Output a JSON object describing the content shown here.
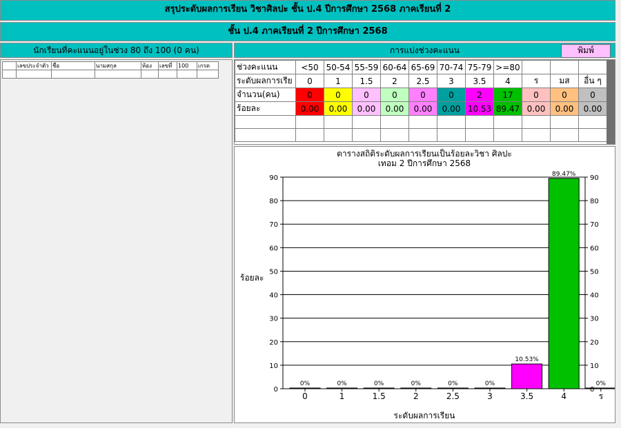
{
  "header": {
    "title": "สรุประดับผลการเรียน วิชาศิลปะ ชั้น ป.4  ปีการศึกษา  2568 ภาคเรียนที่  2",
    "subtitle": "ชั้น ป.4 ภาคเรียนที่  2  ปีการศึกษา  2568"
  },
  "left_panel": {
    "heading": "นักเรียนที่คะแนนอยู่ในช่วง 80 ถึง 100 (0 คน)",
    "columns": [
      "",
      "เลขประจำตัว",
      "ชื่อ",
      "นามสกุล",
      "ห้อง",
      "เลขที่",
      "100",
      "เกรด"
    ]
  },
  "right_panel": {
    "heading": "การแบ่งช่วงคะแนน",
    "print_label": "พิมพ์"
  },
  "grade_table": {
    "row_labels": [
      "ช่วงคะแนน",
      "ระดับผลการเรีย",
      "จำนวน(คน)",
      "ร้อยละ"
    ],
    "ranges": [
      "<50",
      "50-54",
      "55-59",
      "60-64",
      "65-69",
      "70-74",
      "75-79",
      ">=80",
      "",
      "",
      ""
    ],
    "levels": [
      "0",
      "1",
      "1.5",
      "2",
      "2.5",
      "3",
      "3.5",
      "4",
      "ร",
      "มส",
      "อื่น ๆ"
    ],
    "counts": [
      "0",
      "0",
      "0",
      "0",
      "0",
      "0",
      "2",
      "17",
      "0",
      "0",
      "0"
    ],
    "percents": [
      "0.00",
      "0.00",
      "0.00",
      "0.00",
      "0.00",
      "0.00",
      "10.53",
      "89.47",
      "0.00",
      "0.00",
      "0.00"
    ],
    "colors": [
      "#ff0000",
      "#ffff00",
      "#ffc0ff",
      "#c0ffc0",
      "#ff80ff",
      "#00a0a0",
      "#ff00ff",
      "#00c000",
      "#ffc0c0",
      "#ffc080",
      "#c0c0c0"
    ]
  },
  "chart_data": {
    "type": "bar",
    "title": "ตารางสถิติระดับผลการเรียนเป็นร้อยละวิชา ศิลปะ",
    "subtitle": "เทอม  2  ปีการศึกษา  2568",
    "xlabel": "ระดับผลการเรียน",
    "ylabel": "ร้อยละ",
    "categories": [
      "0",
      "1",
      "1.5",
      "2",
      "2.5",
      "3",
      "3.5",
      "4",
      "ร"
    ],
    "values": [
      0,
      0,
      0,
      0,
      0,
      0,
      10.53,
      89.47,
      0
    ],
    "value_labels": [
      "0%",
      "0%",
      "0%",
      "0%",
      "0%",
      "0%",
      "10.53%",
      "89.47%",
      "0%"
    ],
    "bar_colors": [
      "#ffffff",
      "#ffffff",
      "#ffffff",
      "#ffffff",
      "#ffffff",
      "#ffffff",
      "#ff00ff",
      "#00c000",
      "#ffffff"
    ],
    "yticks": [
      "0",
      "10",
      "20",
      "30",
      "40",
      "50",
      "60",
      "70",
      "80",
      "90"
    ],
    "ylim": [
      0,
      90
    ],
    "grid": true,
    "secondary_y_axis": true
  }
}
